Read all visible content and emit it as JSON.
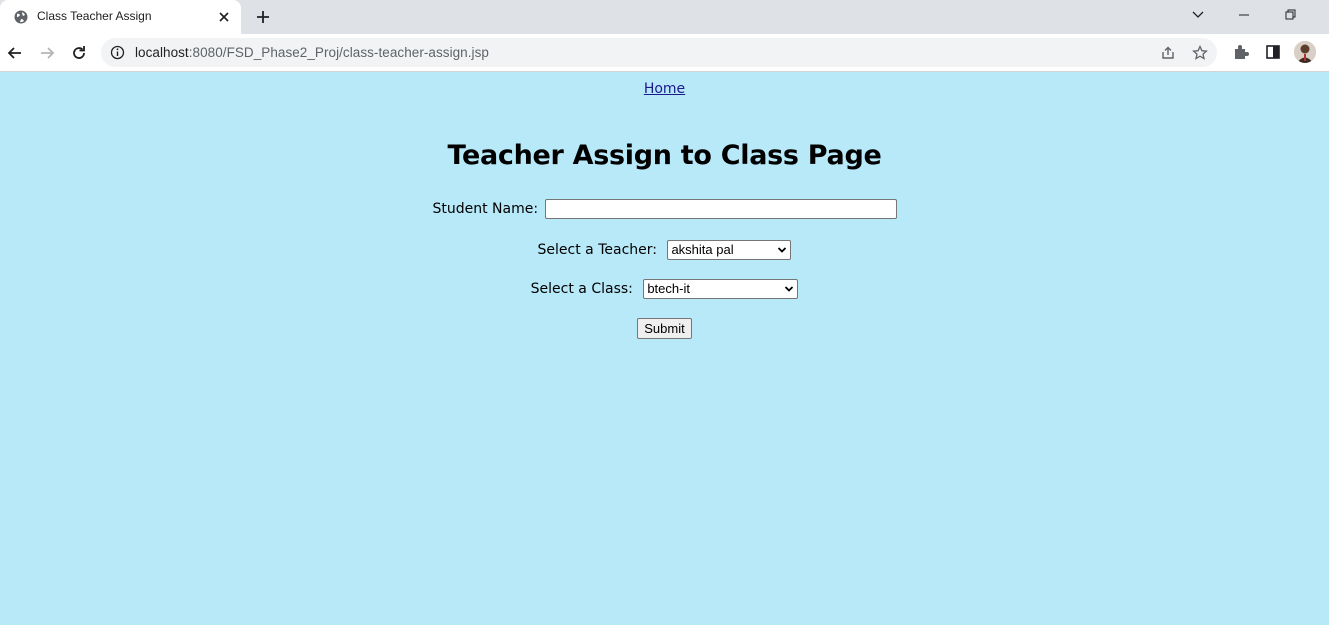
{
  "browser": {
    "tab_title": "Class Teacher Assign",
    "url_host": "localhost",
    "url_path": ":8080/FSD_Phase2_Proj/class-teacher-assign.jsp"
  },
  "page": {
    "home_link": "Home",
    "title": "Teacher Assign to Class Page",
    "student_name_label": "Student Name:",
    "student_name_value": "",
    "teacher_label": "Select a Teacher:",
    "teacher_selected": "akshita pal",
    "class_label": "Select a Class:",
    "class_selected": "btech-it",
    "submit_label": "Submit"
  },
  "colors": {
    "page_background": "#b8e9f9",
    "tabstrip_background": "#dee1e6"
  }
}
